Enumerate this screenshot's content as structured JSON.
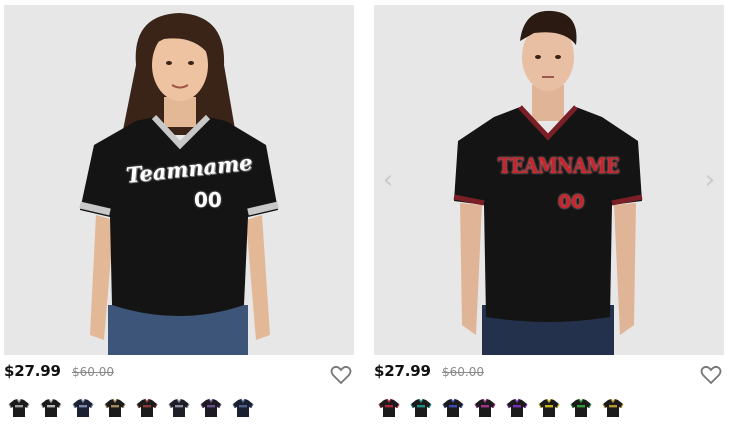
{
  "products": [
    {
      "jersey_text": "Teamname",
      "jersey_number": "00",
      "price": "$27.99",
      "old_price": "$60.00",
      "favorite_icon": "heart-outline-icon",
      "has_nav_arrows": false,
      "jersey_colors": {
        "body": "#141414",
        "trim": "#c8c8c8",
        "lettering": "#ffffff"
      },
      "swatches": [
        {
          "body": "#1b1b1b",
          "trim": "#9a9a9a"
        },
        {
          "body": "#1b1b1b",
          "trim": "#b9b9b9"
        },
        {
          "body": "#1c2233",
          "trim": "#7a8aa8"
        },
        {
          "body": "#1b1b1b",
          "trim": "#a08a5a"
        },
        {
          "body": "#1b1b1b",
          "trim": "#8a3a3a"
        },
        {
          "body": "#1f1f28",
          "trim": "#8c8c9c"
        },
        {
          "body": "#1d1a24",
          "trim": "#6a4f86"
        },
        {
          "body": "#1a2030",
          "trim": "#4b5f8a"
        }
      ]
    },
    {
      "jersey_text": "TEAMNAME",
      "jersey_number": "00",
      "price": "$27.99",
      "old_price": "$60.00",
      "favorite_icon": "heart-outline-icon",
      "has_nav_arrows": true,
      "prev_icon": "chevron-left-icon",
      "next_icon": "chevron-right-icon",
      "jersey_colors": {
        "body": "#141414",
        "trim": "#7a1f26",
        "lettering": "#c9242d"
      },
      "swatches": [
        {
          "body": "#1b1b1b",
          "trim": "#b0263a"
        },
        {
          "body": "#1b1b1b",
          "trim": "#1f8f86"
        },
        {
          "body": "#1b1b1b",
          "trim": "#3b4bb0"
        },
        {
          "body": "#1b1b1b",
          "trim": "#a2318c"
        },
        {
          "body": "#1b1b1b",
          "trim": "#7a2fb8"
        },
        {
          "body": "#1b1b1b",
          "trim": "#c9b21f"
        },
        {
          "body": "#1b1b1b",
          "trim": "#2f9a3a"
        },
        {
          "body": "#1b1b1b",
          "trim": "#b8962f"
        }
      ]
    }
  ]
}
